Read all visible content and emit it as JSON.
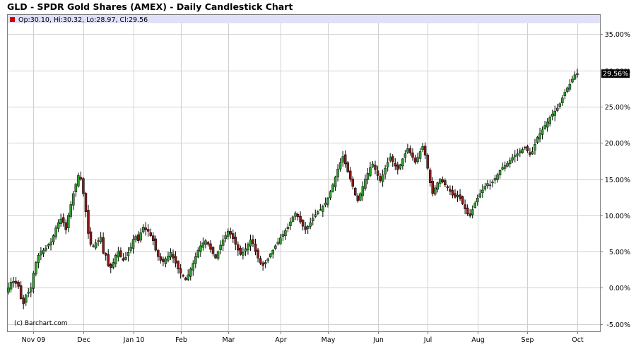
{
  "title": "GLD - SPDR Gold Shares (AMEX) - Daily Candlestick Chart",
  "legend": {
    "swatch_color": "#cc0000",
    "text": "Op:30.10, Hi:30.32, Lo:28.97, Cl:29.56"
  },
  "credit": "(c) Barchart.com",
  "last_value_label": "29.56%",
  "colors": {
    "up": "#2ea02e",
    "down": "#8b1a1a",
    "grid": "#d0d0d0",
    "legend_bg": "#e0e0f8",
    "last_bg": "#000000"
  },
  "chart_data": {
    "type": "candlestick",
    "title": "GLD - SPDR Gold Shares (AMEX) - Daily Candlestick Chart",
    "y_unit": "%",
    "ylim": [
      -6.0,
      36.5
    ],
    "y_ticks": [
      -5,
      0,
      5,
      10,
      15,
      20,
      25,
      30,
      35
    ],
    "y_tick_labels": [
      "-5.00%",
      "0.00%",
      "5.00%",
      "10.00%",
      "15.00%",
      "20.00%",
      "25.00%",
      "30.00%",
      "35.00%"
    ],
    "x_ticks": [
      {
        "label": "Nov 09",
        "index": 10
      },
      {
        "label": "Dec",
        "index": 30
      },
      {
        "label": "Jan 10",
        "index": 50
      },
      {
        "label": "Feb",
        "index": 69
      },
      {
        "label": "Mar",
        "index": 88
      },
      {
        "label": "Apr",
        "index": 109
      },
      {
        "label": "May",
        "index": 128
      },
      {
        "label": "Jun",
        "index": 148
      },
      {
        "label": "Jul",
        "index": 168
      },
      {
        "label": "Aug",
        "index": 188
      },
      {
        "label": "Sep",
        "index": 208
      },
      {
        "label": "Oct",
        "index": 228
      }
    ],
    "grid": true,
    "last_value": 29.56,
    "closes": [
      0.0,
      0.8,
      0.9,
      0.6,
      0.2,
      -1.5,
      -2.2,
      -1.0,
      -0.6,
      0.0,
      2.0,
      3.5,
      4.5,
      5.0,
      5.2,
      5.5,
      6.0,
      6.3,
      7.2,
      8.3,
      9.0,
      9.5,
      9.0,
      8.0,
      10.0,
      11.5,
      13.0,
      14.3,
      15.5,
      15.0,
      13.0,
      10.5,
      7.5,
      6.0,
      5.8,
      6.2,
      6.5,
      7.0,
      4.8,
      4.5,
      3.0,
      2.8,
      3.5,
      4.5,
      5.0,
      4.3,
      3.8,
      4.2,
      4.9,
      5.6,
      6.7,
      7.1,
      6.5,
      7.6,
      8.4,
      8.0,
      7.8,
      7.2,
      6.5,
      5.2,
      4.3,
      3.8,
      3.6,
      4.0,
      4.4,
      4.9,
      4.1,
      3.4,
      2.6,
      2.0,
      1.6,
      1.1,
      1.8,
      2.6,
      3.4,
      4.3,
      5.2,
      5.8,
      6.2,
      6.5,
      6.0,
      5.3,
      4.7,
      4.1,
      5.0,
      5.9,
      6.6,
      7.2,
      7.8,
      7.4,
      6.8,
      6.0,
      5.2,
      4.6,
      4.9,
      5.4,
      6.0,
      6.6,
      6.1,
      5.0,
      4.1,
      3.4,
      3.1,
      3.5,
      4.0,
      4.7,
      5.2,
      5.8,
      6.3,
      6.9,
      7.4,
      7.9,
      8.4,
      9.1,
      9.8,
      10.3,
      9.8,
      9.1,
      8.5,
      8.0,
      8.5,
      9.0,
      9.6,
      10.1,
      10.5,
      10.8,
      11.2,
      11.7,
      12.4,
      13.3,
      14.2,
      15.3,
      16.4,
      17.3,
      18.1,
      17.1,
      16.0,
      15.0,
      14.0,
      12.8,
      12.0,
      13.0,
      14.0,
      15.0,
      15.8,
      16.6,
      17.1,
      16.3,
      15.5,
      14.8,
      15.6,
      16.5,
      17.3,
      18.0,
      17.4,
      16.8,
      16.3,
      17.0,
      17.8,
      18.5,
      19.2,
      18.6,
      18.0,
      17.3,
      18.0,
      18.8,
      19.5,
      18.3,
      16.5,
      14.5,
      13.0,
      13.8,
      14.5,
      15.0,
      14.6,
      14.2,
      13.8,
      13.3,
      12.8,
      12.5,
      12.8,
      12.3,
      11.6,
      10.9,
      10.2,
      9.9,
      10.8,
      11.7,
      12.4,
      13.0,
      13.5,
      14.0,
      14.4,
      14.2,
      14.6,
      15.1,
      15.6,
      16.2,
      16.6,
      16.9,
      17.2,
      17.6,
      18.0,
      18.3,
      18.5,
      18.9,
      19.1,
      19.4,
      18.9,
      18.4,
      18.8,
      19.8,
      20.8,
      21.3,
      21.8,
      22.4,
      22.9,
      23.5,
      24.0,
      24.4,
      24.8,
      25.4,
      26.2,
      27.0,
      27.6,
      28.1,
      28.8,
      29.4,
      29.56
    ]
  }
}
